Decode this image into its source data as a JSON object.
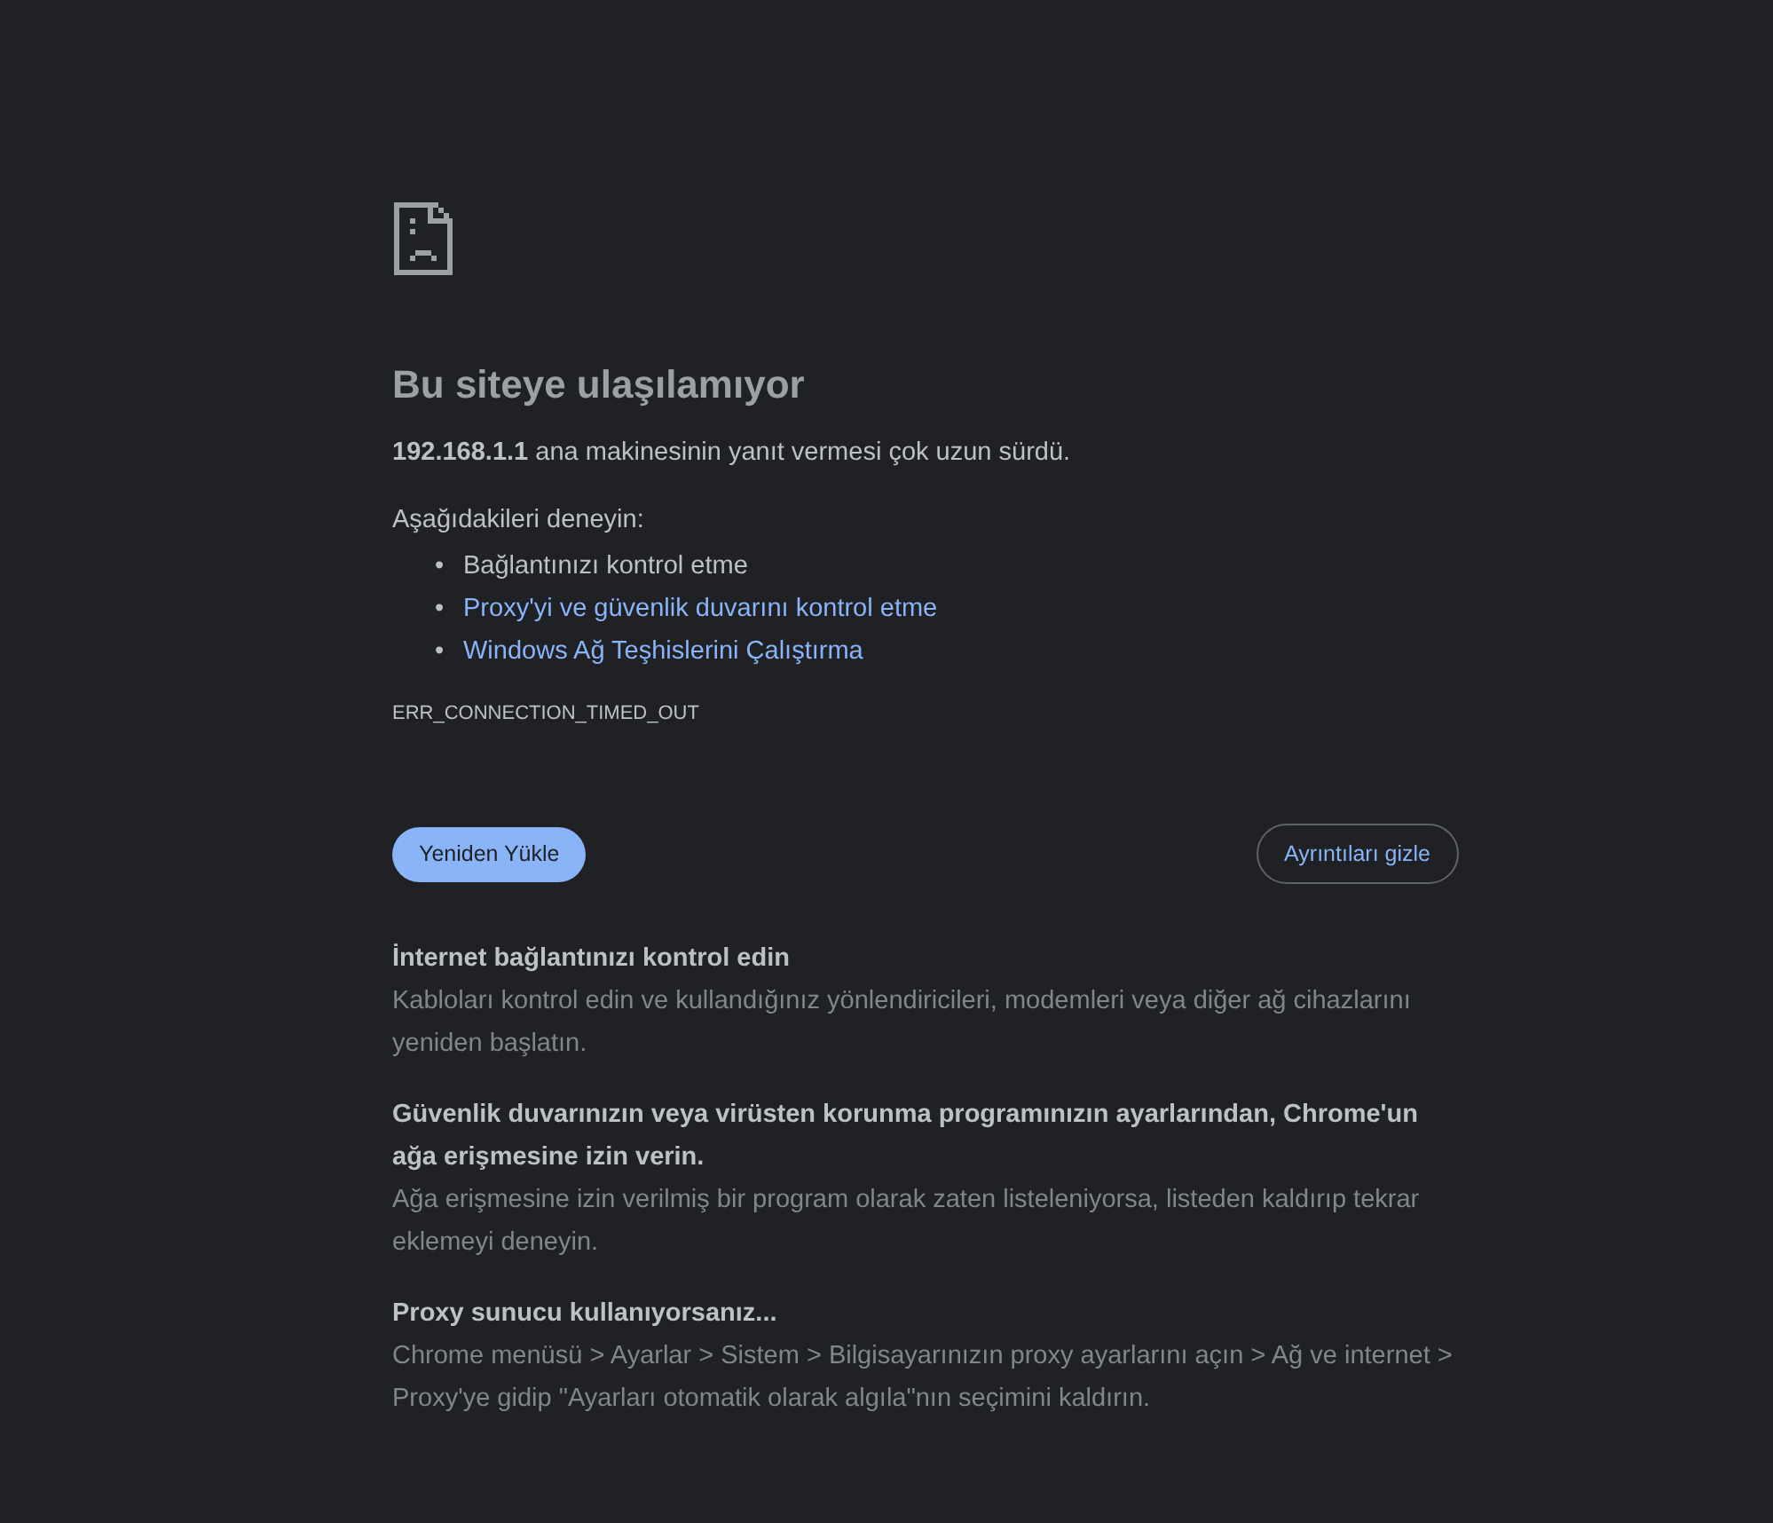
{
  "heading": "Bu siteye ulaşılamıyor",
  "summary": "**192.168.1.1** ana makinesinin yanıt vermesi çok uzun sürdü.",
  "suggestions_title": "Aşağıdakileri deneyin:",
  "suggestions": [
    {
      "kind": "text",
      "bullet": "•",
      "label": "Bağlantınızı kontrol etme"
    },
    {
      "kind": "link",
      "bullet": "•",
      "label": "Proxy'yi ve güvenlik duvarını kontrol etme"
    },
    {
      "kind": "link",
      "bullet": "•",
      "label": "Windows Ağ Teşhislerini Çalıştırma"
    }
  ],
  "error_code": "ERR_CONNECTION_TIMED_OUT",
  "buttons": {
    "reload": "Yeniden Yükle",
    "details": "Ayrıntıları gizle"
  },
  "details": [
    {
      "title": "İnternet bağlantınızı kontrol edin",
      "body": "Kabloları kontrol edin ve kullandığınız yönlendiricileri, modemleri veya diğer ağ cihazlarını yeniden başlatın."
    },
    {
      "title": "Güvenlik duvarınızın veya virüsten korunma programınızın ayarlarından, Chrome'un ağa erişmesine izin verin.",
      "body": "Ağa erişmesine izin verilmiş bir program olarak zaten listeleniyorsa, listeden kaldırıp tekrar eklemeyi deneyin."
    },
    {
      "title": "Proxy sunucu kullanıyorsanız...",
      "body": "Chrome menüsü > Ayarlar > Sistem > Bilgisayarınızın proxy ayarlarını açın > Ağ ve internet > Proxy'ye gidip \"Ayarları otomatik olarak algıla\"nın seçimini kaldırın."
    }
  ]
}
